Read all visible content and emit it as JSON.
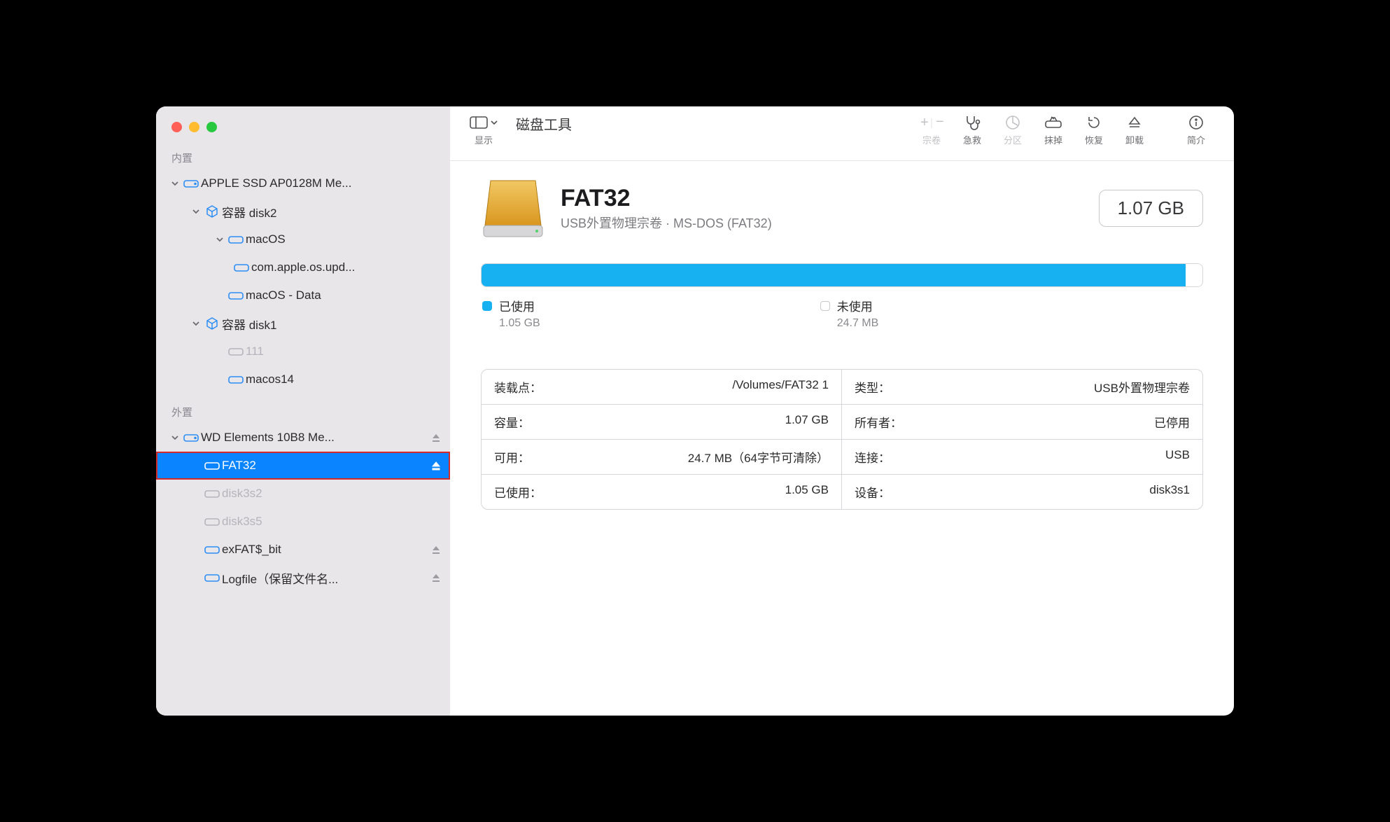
{
  "toolbar": {
    "view_label": "显示",
    "app_title": "磁盘工具",
    "buttons": {
      "volume": "宗卷",
      "firstaid": "急救",
      "partition": "分区",
      "erase": "抹掉",
      "restore": "恢复",
      "unmount": "卸载",
      "info": "简介"
    }
  },
  "sidebar": {
    "section_internal": "内置",
    "section_external": "外置",
    "items": {
      "apple_ssd": "APPLE SSD AP0128M Me...",
      "container2": "容器 disk2",
      "macos": "macOS",
      "update": "com.apple.os.upd...",
      "macos_data": "macOS - Data",
      "container1": "容器 disk1",
      "v111": "111",
      "macos14": "macos14",
      "wd": "WD Elements 10B8 Me...",
      "fat32": "FAT32",
      "d3s2": "disk3s2",
      "d3s5": "disk3s5",
      "exfat": "exFAT$_bit",
      "logfile": "Logfile（保留文件名..."
    }
  },
  "volume": {
    "name": "FAT32",
    "subtitle": "USB外置物理宗卷 · MS-DOS (FAT32)",
    "size": "1.07 GB"
  },
  "usage": {
    "used_pct": 97.7,
    "legend": {
      "used_label": "已使用",
      "used_val": "1.05 GB",
      "free_label": "未使用",
      "free_val": "24.7 MB"
    }
  },
  "info": {
    "mount_k": "装载点：",
    "mount_v": "/Volumes/FAT32 1",
    "type_k": "类型：",
    "type_v": "USB外置物理宗卷",
    "cap_k": "容量：",
    "cap_v": "1.07 GB",
    "owner_k": "所有者：",
    "owner_v": "已停用",
    "avail_k": "可用：",
    "avail_v": "24.7 MB（64字节可清除）",
    "conn_k": "连接：",
    "conn_v": "USB",
    "used_k": "已使用：",
    "used_v": "1.05 GB",
    "dev_k": "设备：",
    "dev_v": "disk3s1"
  }
}
